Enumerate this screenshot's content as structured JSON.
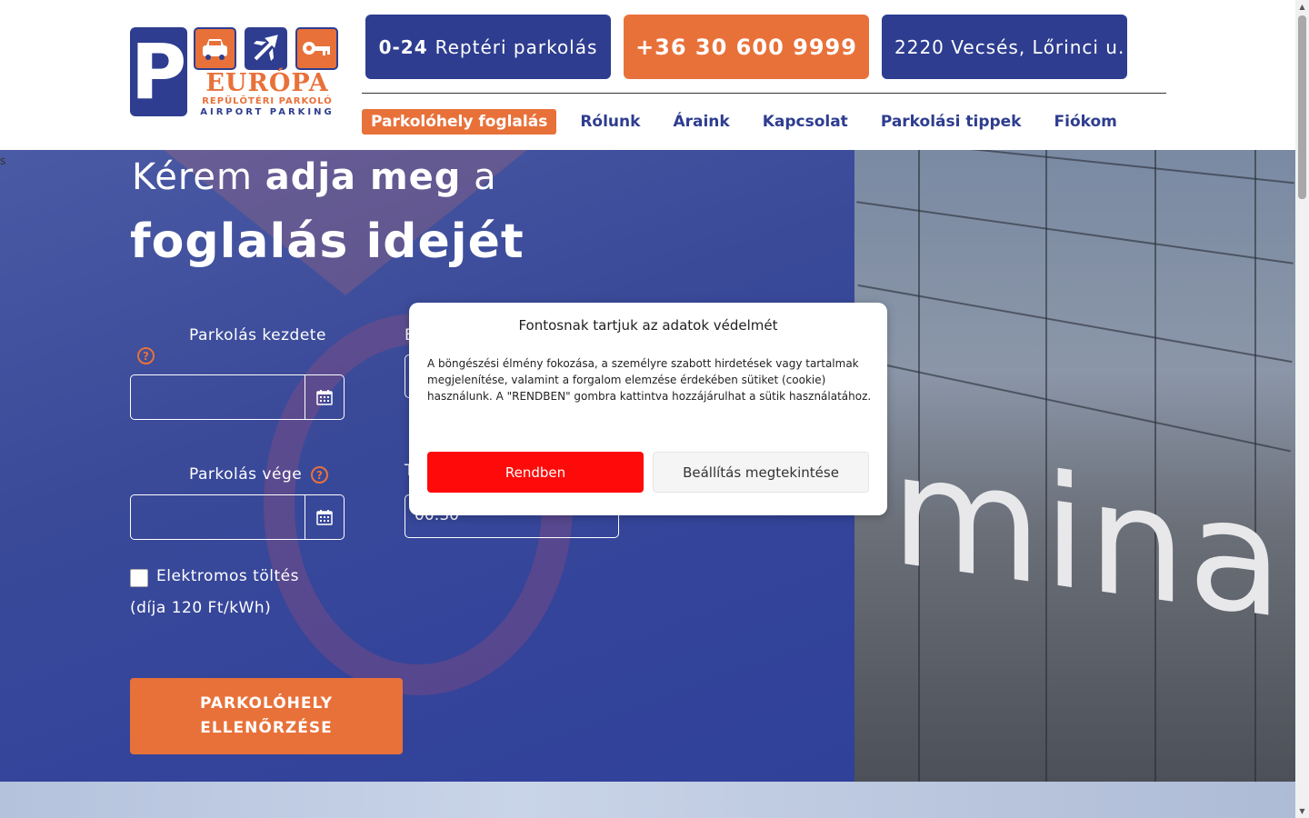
{
  "logo": {
    "letter": "P",
    "brand": "EURÓPA",
    "subtitle_hu": "REPÜLŐTÉRI PARKOLÓ",
    "subtitle_en": "AIRPORT PARKING"
  },
  "header": {
    "hours_bold": "0-24",
    "hours_text": "Reptéri parkolás",
    "phone": "+36 30 600 9999",
    "address": "2220 Vecsés, Lőrinci u."
  },
  "nav": {
    "items": [
      {
        "label": "Parkolóhely foglalás",
        "active": true
      },
      {
        "label": "Rólunk"
      },
      {
        "label": "Áraink"
      },
      {
        "label": "Kapcsolat"
      },
      {
        "label": "Parkolási tippek"
      },
      {
        "label": "Fiókom"
      }
    ]
  },
  "hero": {
    "title_part1": "Kérem",
    "title_part2": "adja meg",
    "title_part3": "a",
    "title_line2": "foglalás idejét",
    "stray_text": "s",
    "background_text": "minal"
  },
  "form": {
    "start_label": "Parkolás kezdete",
    "end_label": "Parkolás vége",
    "time_start_label_partial": "E",
    "time_end_label_partial": "T",
    "time_end_value_partial": "00:30",
    "help_symbol": "?",
    "ev_label": "Elektromos töltés",
    "ev_note": "(díja 120 Ft/kWh)",
    "submit_line1": "PARKOLÓHELY",
    "submit_line2": "ELLENŐRZÉSE"
  },
  "cookie": {
    "title": "Fontosnak tartjuk az adatok védelmét",
    "text": "A böngészési élmény fokozása, a személyre szabott hirdetések vagy tartalmak megjelenítése, valamint a forgalom elemzése érdekében sütiket (cookie) használunk. A \"RENDBEN\" gombra kattintva hozzájárulhat a sütik használatához.",
    "accept": "Rendben",
    "settings": "Beállítás megtekintése"
  },
  "colors": {
    "brand_blue": "#2e3d8f",
    "brand_orange": "#e8713a",
    "accept_red": "#ff0a0a"
  },
  "icons": [
    "car-icon",
    "plane-icon",
    "key-icon",
    "help-icon",
    "calendar-icon"
  ]
}
